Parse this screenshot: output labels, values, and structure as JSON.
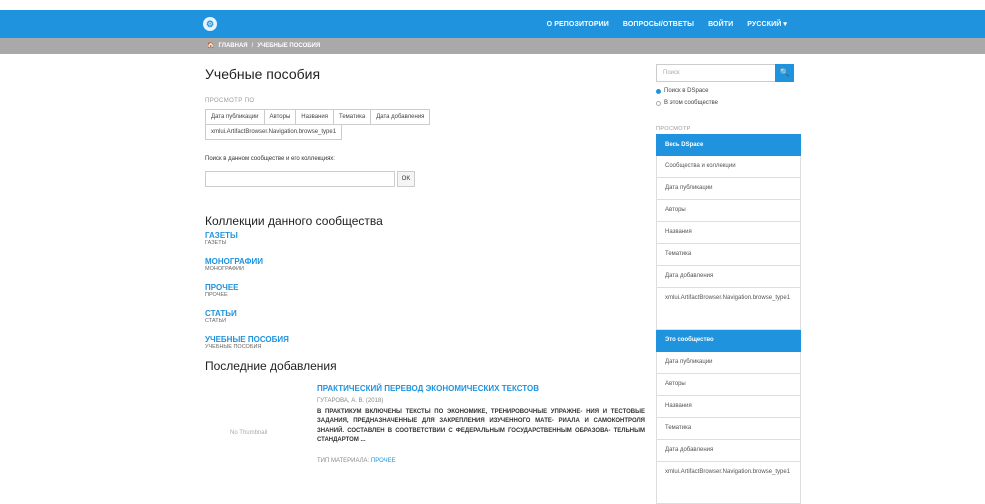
{
  "header": {
    "logo": "⚙",
    "links": [
      "О РЕПОЗИТОРИИ",
      "ВОПРОСЫ/ОТВЕТЫ",
      "ВОЙТИ",
      "РУССКИЙ ▾"
    ]
  },
  "breadcrumb": {
    "home": "ГЛАВНАЯ",
    "separator": "/",
    "current": "УЧЕБНЫЕ ПОСОБИЯ"
  },
  "page": {
    "title": "Учебные пособия",
    "browse_by": "ПРОСМОТР ПО",
    "browse_buttons": [
      "Дата публикации",
      "Авторы",
      "Названия",
      "Тематика",
      "Дата добавления",
      "xmlui.ArtifactBrowser.Navigation.browse_type1"
    ],
    "search_label": "Поиск в данном сообществе и его коллекциях:",
    "search_value": "",
    "ok_label": "OK"
  },
  "collections": {
    "title": "Коллекции данного сообщества",
    "items": [
      {
        "name": "ГАЗЕТЫ",
        "desc": "ГАЗЕТЫ"
      },
      {
        "name": "МОНОГРАФИИ",
        "desc": "МОНОГРАФИИ"
      },
      {
        "name": "ПРОЧЕЕ",
        "desc": "ПРОЧЕЕ"
      },
      {
        "name": "СТАТЬИ",
        "desc": "СТАТЬИ"
      },
      {
        "name": "УЧЕБНЫЕ ПОСОБИЯ",
        "desc": "УЧЕБНЫЕ ПОСОБИЯ"
      }
    ]
  },
  "recent": {
    "title": "Последние добавления",
    "thumbnail": "No Thumbnail",
    "item_title": "ПРАКТИЧЕСКИЙ ПЕРЕВОД ЭКОНОМИЧЕСКИХ ТЕКСТОВ",
    "item_meta": "ГУТАРОВА, А. В. (2018)",
    "item_abstract": "В ПРАКТИКУМ ВКЛЮЧЕНЫ ТЕКСТЫ ПО ЭКОНОМИКЕ, ТРЕНИРОВОЧНЫЕ УПРАЖНЕ- НИЯ И ТЕСТОВЫЕ ЗАДАНИЯ, ПРЕДНАЗНАЧЕННЫЕ ДЛЯ ЗАКРЕПЛЕНИЯ ИЗУЧЕННОГО МАТЕ- РИАЛА И САМОКОНТРОЛЯ ЗНАНИЙ. СОСТАВЛЕН В СООТВЕТСТВИИ С ФЕДЕРАЛЬНЫМ ГОСУДАРСТВЕННЫМ ОБРАЗОВА- ТЕЛЬНЫМ СТАНДАРТОМ ...",
    "item_type_label": "ТИП МАТЕРИАЛА:",
    "item_type_value": "ПРОЧЕЕ"
  },
  "sidebar": {
    "search_placeholder": "Поиск",
    "search_button": "🔍",
    "radio_all": "Поиск в DSpace",
    "radio_community": "В этом сообществе",
    "browse_header": "ПРОСМОТР",
    "items": [
      "Весь DSpace",
      "Сообщества и коллекции",
      "Дата публикации",
      "Авторы",
      "Названия",
      "Тематика",
      "Дата добавления",
      "xmlui.ArtifactBrowser.Navigation.browse_type1",
      "Это сообщество",
      "Дата публикации",
      "Авторы",
      "Названия",
      "Тематика",
      "Дата добавления",
      "xmlui.ArtifactBrowser.Navigation.browse_type1"
    ]
  },
  "colors": {
    "accent": "#1f93dd",
    "crumb_bar": "#a9a9a9"
  }
}
